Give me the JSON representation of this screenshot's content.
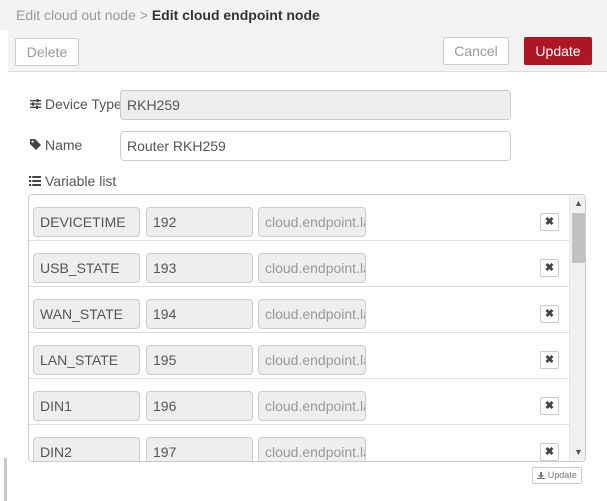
{
  "breadcrumb": {
    "previous": "Edit cloud out node",
    "separator": ">",
    "current": "Edit cloud endpoint node"
  },
  "toolbar": {
    "delete_label": "Delete",
    "cancel_label": "Cancel",
    "update_label": "Update"
  },
  "form": {
    "device_type": {
      "label": "Device Type",
      "value": "RKH259"
    },
    "name": {
      "label": "Name",
      "value": "Router RKH259"
    },
    "variable_list": {
      "label": "Variable list"
    }
  },
  "variables": [
    {
      "name": "DEVICETIME",
      "index": "192",
      "path": "cloud.endpoint.la"
    },
    {
      "name": "USB_STATE",
      "index": "193",
      "path": "cloud.endpoint.la"
    },
    {
      "name": "WAN_STATE",
      "index": "194",
      "path": "cloud.endpoint.la"
    },
    {
      "name": "LAN_STATE",
      "index": "195",
      "path": "cloud.endpoint.la"
    },
    {
      "name": "DIN1",
      "index": "196",
      "path": "cloud.endpoint.la"
    },
    {
      "name": "DIN2",
      "index": "197",
      "path": "cloud.endpoint.la"
    }
  ],
  "list_footer": {
    "update_label": "Update"
  },
  "colors": {
    "primary": "#ad1625",
    "toolbar_bg": "#f3f3f3",
    "readonly_bg": "#eeeeee"
  }
}
